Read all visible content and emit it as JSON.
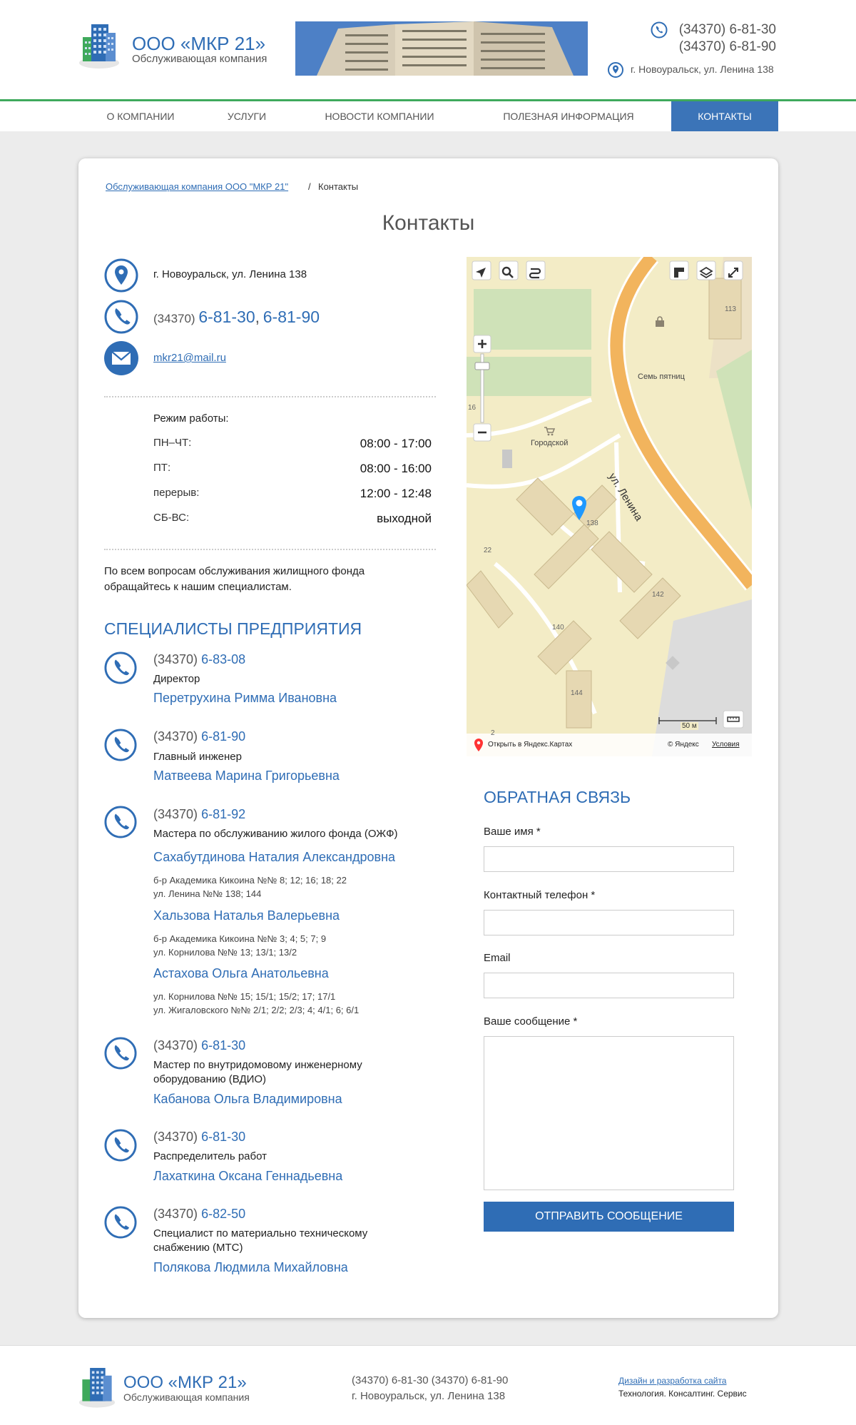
{
  "header": {
    "brand_name": "ООО «МКР 21»",
    "brand_sub": "Обслуживающая компания",
    "phone1": "(34370) 6-81-30",
    "phone2": "(34370) 6-81-90",
    "address": "г. Новоуральск, ул. Ленина 138"
  },
  "nav": {
    "items": [
      {
        "label": "О КОМПАНИИ"
      },
      {
        "label": "УСЛУГИ"
      },
      {
        "label": "НОВОСТИ КОМПАНИИ"
      },
      {
        "label": "ПОЛЕЗНАЯ ИНФОРМАЦИЯ"
      },
      {
        "label": "КОНТАКТЫ"
      }
    ]
  },
  "breadcrumb": {
    "home": "Обслуживающая компания ООО \"МКР 21\"",
    "sep": "/",
    "current": "Контакты"
  },
  "page_title": "Контакты",
  "contacts": {
    "address": "г. Новоуральск, ул. Ленина 138",
    "phone_prefix": "(34370)",
    "phone_a": "6-81-30",
    "phone_sep": ",",
    "phone_b": "6-81-90",
    "email": "mkr21@mail.ru"
  },
  "schedule": {
    "title": "Режим работы:",
    "rows": [
      {
        "day": "ПН–ЧТ:",
        "time": "08:00 - 17:00"
      },
      {
        "day": "ПТ:",
        "time": "08:00 - 16:00"
      },
      {
        "day": "перерыв:",
        "time": "12:00 - 12:48"
      },
      {
        "day": "СБ-ВС:",
        "time": "выходной"
      }
    ]
  },
  "note": "По всем вопросам обслуживания жилищного фонда обращайтесь к нашим специалистам.",
  "specialists_title": "СПЕЦИАЛИСТЫ ПРЕДПРИЯТИЯ",
  "specialists": [
    {
      "prefix": "(34370)",
      "num": "6-83-08",
      "role": "Директор",
      "names": [
        "Перетрухина Римма Ивановна"
      ],
      "areas": []
    },
    {
      "prefix": "(34370)",
      "num": "6-81-90",
      "role": "Главный инженер",
      "names": [
        "Матвеева Марина Григорьевна"
      ],
      "areas": []
    },
    {
      "prefix": "(34370)",
      "num": "6-81-92",
      "role": "Мастера по обслуживанию жилого фонда (ОЖФ)",
      "names": [
        "Сахабутдинова Наталия Александровна",
        "Хальзова Наталья Валерьевна",
        "Астахова Ольга Анатольевна"
      ],
      "areas": [
        [
          "б-р Академика Кикоина №№ 8; 12; 16; 18; 22",
          "ул. Ленина №№ 138; 144"
        ],
        [
          "б-р Академика Кикоина №№ 3; 4; 5; 7; 9",
          "ул. Корнилова №№ 13; 13/1; 13/2"
        ],
        [
          "ул. Корнилова №№ 15; 15/1; 15/2; 17; 17/1",
          "ул. Жигаловского №№ 2/1; 2/2; 2/3; 4; 4/1; 6; 6/1"
        ]
      ]
    },
    {
      "prefix": "(34370)",
      "num": "6-81-30",
      "role_lines": [
        "Мастер по внутридомовому инженерному",
        "оборудованию (ВДИО)"
      ],
      "names": [
        "Кабанова Ольга Владимировна"
      ],
      "areas": []
    },
    {
      "prefix": "(34370)",
      "num": "6-81-30",
      "role": "Распределитель работ",
      "names": [
        "Лахаткина Оксана Геннадьевна"
      ],
      "areas": []
    },
    {
      "prefix": "(34370)",
      "num": "6-82-50",
      "role_lines": [
        "Специалист по материально техническому",
        "снабжению (МТС)"
      ],
      "names": [
        "Полякова Людмила Михайловна"
      ],
      "areas": []
    }
  ],
  "map": {
    "labels": {
      "b113": "113",
      "shop": "Семь пятниц",
      "b16": "16",
      "gorodskoy": "Городской",
      "street": "ул. Ленина",
      "b138": "138",
      "b22": "22",
      "b142": "142",
      "b140": "140",
      "b144": "144",
      "b2": "2"
    },
    "scale": "50 м",
    "open_link": "Открыть в Яндекс.Картах",
    "copyright": "© Яндекс",
    "terms": "Условия"
  },
  "feedback": {
    "title": "ОБРАТНАЯ СВЯЗЬ",
    "name_label": "Ваше имя *",
    "phone_label": "Контактный телефон *",
    "email_label": "Email",
    "message_label": "Ваше сообщение *",
    "submit": "ОТПРАВИТЬ СООБЩЕНИЕ"
  },
  "footer": {
    "brand_name": "ООО «МКР 21»",
    "brand_sub": "Обслуживающая компания",
    "phones": "(34370) 6-81-30 (34370) 6-81-90",
    "address": "г. Новоуральск, ул. Ленина 138",
    "dev_link": "Дизайн и разработка сайта",
    "dev_name": "Технология. Консалтинг. Сервис"
  },
  "colors": {
    "accent": "#2f6db5",
    "nav_active": "#3b74b8",
    "header_line": "#3fa95c",
    "map_road": "#f2b45d",
    "map_bg": "#f3ecc6"
  }
}
